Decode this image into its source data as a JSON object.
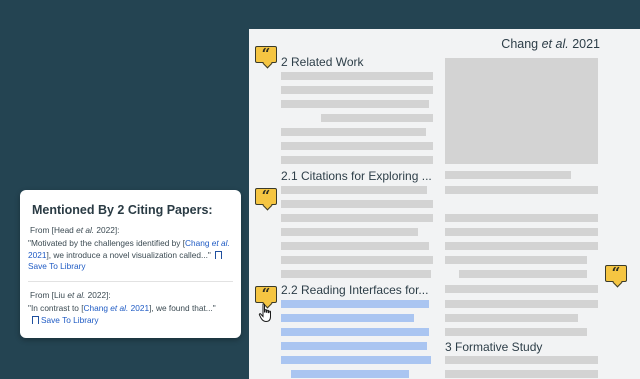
{
  "paper": {
    "header": "Chang et al. 2021",
    "header_author": "Chang ",
    "header_etal": "et al.",
    "header_year": " 2021",
    "sections": {
      "related_work": "2 Related Work",
      "citations_for_exploring": "2.1 Citations for Exploring ...",
      "reading_interfaces": "2.2 Reading Interfaces for...",
      "formative_study": "3 Formative Study"
    }
  },
  "popup": {
    "title": "Mentioned By 2 Citing Papers:",
    "entries": [
      {
        "from_prefix": "From [Head ",
        "from_etal": "et al.",
        "from_suffix": " 2022]:",
        "quote_start": "\"Motivated by the challenges identified by [",
        "link_text_1": "Chang",
        "link_etal": "et al.",
        "link_text_2": " 2021",
        "quote_end": "], we introduce a novel visualization called...\"",
        "save_label": "Save To Library"
      },
      {
        "from_prefix": "From [Liu ",
        "from_etal": "et al.",
        "from_suffix": " 2022]:",
        "quote_start": "\"In contrast to [",
        "link_text_1": "Chang ",
        "link_etal": "et al.",
        "link_text_2": " 2021",
        "quote_end": "], we found that...\"",
        "save_label": "Save To Library"
      }
    ]
  },
  "icons": {
    "citation_marker": "quote-icon",
    "cursor": "hand-pointer-icon",
    "bookmark": "bookmark-icon"
  },
  "colors": {
    "background": "#244452",
    "marker": "#f5c542",
    "highlight": "#aac5f1",
    "link": "#1f5bc4"
  }
}
